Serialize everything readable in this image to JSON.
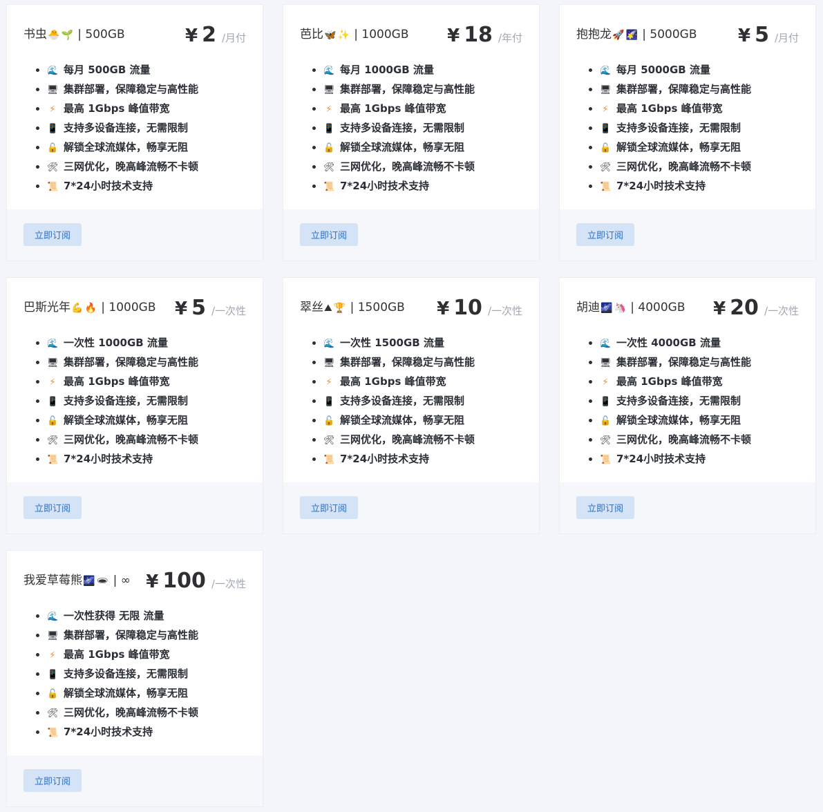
{
  "feature_icons": [
    "wave-icon",
    "monitor-icon",
    "lightning-icon",
    "phone-icon",
    "unlock-icon",
    "tools-icon",
    "scroll-icon"
  ],
  "plans": [
    {
      "name": "书虫",
      "emoji1": "🐣",
      "emoji2": "🌱",
      "data": "| 500GB",
      "currency": "¥",
      "amount": "2",
      "period": "/月付",
      "features": [
        "每月 500GB 流量",
        "集群部署，保障稳定与高性能",
        "最高 1Gbps 峰值带宽",
        "支持多设备连接，无需限制",
        "解锁全球流媒体，畅享无阻",
        "三网优化，晚高峰流畅不卡顿",
        "7*24小时技术支持"
      ],
      "button": "立即订阅"
    },
    {
      "name": "芭比",
      "emoji1": "🦋",
      "emoji2": "✨",
      "data": "| 1000GB",
      "currency": "¥",
      "amount": "18",
      "period": "/年付",
      "features": [
        "每月 1000GB 流量",
        "集群部署，保障稳定与高性能",
        "最高 1Gbps 峰值带宽",
        "支持多设备连接，无需限制",
        "解锁全球流媒体，畅享无阻",
        "三网优化，晚高峰流畅不卡顿",
        "7*24小时技术支持"
      ],
      "button": "立即订阅"
    },
    {
      "name": "抱抱龙",
      "emoji1": "🚀",
      "emoji2": "🌠",
      "data": "| 5000GB",
      "currency": "¥",
      "amount": "5",
      "period": "/月付",
      "features": [
        "每月 5000GB 流量",
        "集群部署，保障稳定与高性能",
        "最高 1Gbps 峰值带宽",
        "支持多设备连接，无需限制",
        "解锁全球流媒体，畅享无阻",
        "三网优化，晚高峰流畅不卡顿",
        "7*24小时技术支持"
      ],
      "button": "立即订阅"
    },
    {
      "name": "巴斯光年",
      "emoji1": "💪",
      "emoji2": "🔥",
      "data": "| 1000GB",
      "currency": "¥",
      "amount": "5",
      "period": "/一次性",
      "features": [
        "一次性 1000GB 流量",
        "集群部署，保障稳定与高性能",
        "最高 1Gbps 峰值带宽",
        "支持多设备连接，无需限制",
        "解锁全球流媒体，畅享无阻",
        "三网优化，晚高峰流畅不卡顿",
        "7*24小时技术支持"
      ],
      "button": "立即订阅"
    },
    {
      "name": "翠丝",
      "emoji1": "⛰",
      "emoji2": "🏆",
      "data": "| 1500GB",
      "currency": "¥",
      "amount": "10",
      "period": "/一次性",
      "features": [
        "一次性 1500GB 流量",
        "集群部署，保障稳定与高性能",
        "最高 1Gbps 峰值带宽",
        "支持多设备连接，无需限制",
        "解锁全球流媒体，畅享无阻",
        "三网优化，晚高峰流畅不卡顿",
        "7*24小时技术支持"
      ],
      "button": "立即订阅"
    },
    {
      "name": "胡迪",
      "emoji1": "🌌",
      "emoji2": "🦄",
      "data": "| 4000GB",
      "currency": "¥",
      "amount": "20",
      "period": "/一次性",
      "features": [
        "一次性 4000GB 流量",
        "集群部署，保障稳定与高性能",
        "最高 1Gbps 峰值带宽",
        "支持多设备连接，无需限制",
        "解锁全球流媒体，畅享无阻",
        "三网优化，晚高峰流畅不卡顿",
        "7*24小时技术支持"
      ],
      "button": "立即订阅"
    },
    {
      "name": "我爱草莓熊",
      "emoji1": "🌌",
      "emoji2": "🕳",
      "data": "| ∞",
      "currency": "¥",
      "amount": "100",
      "period": "/一次性",
      "features": [
        "一次性获得 无限 流量",
        "集群部署，保障稳定与高性能",
        "最高 1Gbps 峰值带宽",
        "支持多设备连接，无需限制",
        "解锁全球流媒体，畅享无阻",
        "三网优化，晚高峰流畅不卡顿",
        "7*24小时技术支持"
      ],
      "button": "立即订阅"
    }
  ]
}
